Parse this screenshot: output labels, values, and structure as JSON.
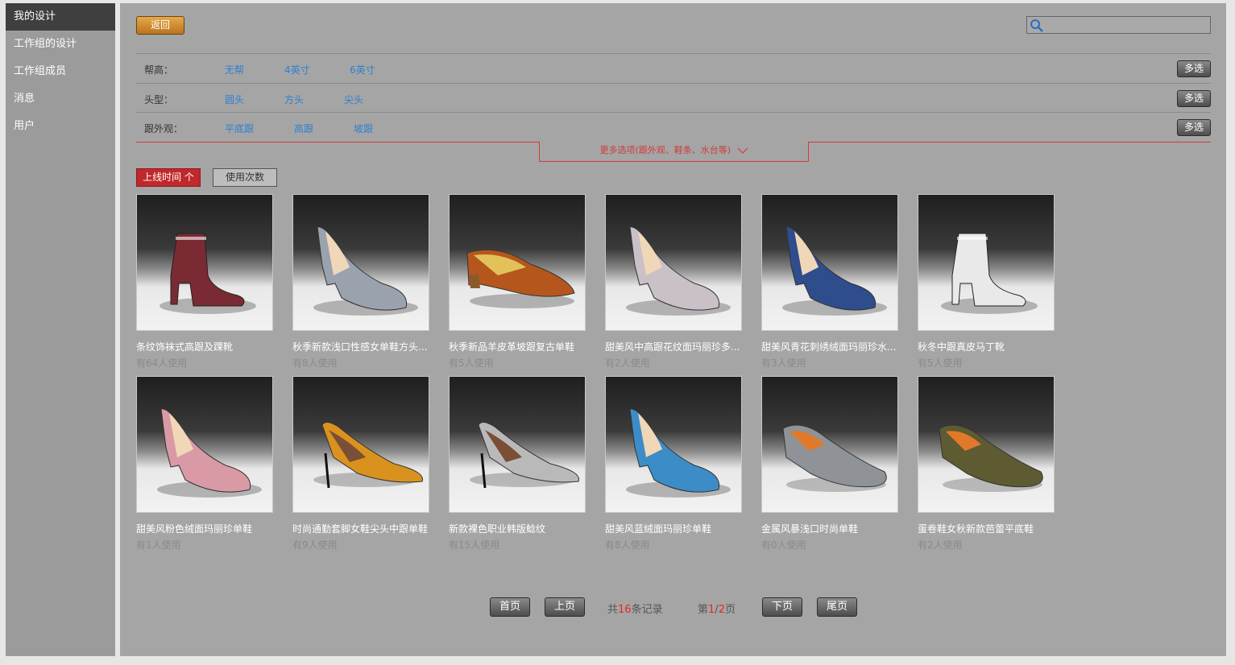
{
  "sidebar": {
    "items": [
      {
        "label": "我的设计",
        "active": true
      },
      {
        "label": "工作组的设计"
      },
      {
        "label": "工作组成员"
      },
      {
        "label": "消息"
      },
      {
        "label": "用户"
      }
    ]
  },
  "toolbar": {
    "back_label": "返回",
    "search_placeholder": ""
  },
  "filters": [
    {
      "label": "帮高：",
      "options": [
        "无帮",
        "4英寸",
        "6英寸"
      ],
      "multi_label": "多选"
    },
    {
      "label": "头型：",
      "options": [
        "圆头",
        "方头",
        "尖头"
      ],
      "multi_label": "多选"
    },
    {
      "label": "跟外观：",
      "options": [
        "平底跟",
        "高跟",
        "坡跟"
      ],
      "multi_label": "多选"
    }
  ],
  "more_options": "更多选项(跟外观、鞋条、水台等)",
  "sort": {
    "active_label": "上线时间",
    "active_arrow": "个",
    "other_label": "使用次数"
  },
  "products": [
    {
      "title": "条纹饰袜式高跟及踝靴",
      "usage": "有64人使用",
      "shoe": "boot",
      "color": "#7a2a32"
    },
    {
      "title": "秋季新款浅口性感女单鞋方头...",
      "usage": "有8人使用",
      "shoe": "pump",
      "color": "#9aa2ad"
    },
    {
      "title": "秋季新品羊皮革坡跟复古单鞋",
      "usage": "有5人使用",
      "shoe": "wedge",
      "color": "#b5561c"
    },
    {
      "title": "甜美风中高跟花纹面玛丽珍多...",
      "usage": "有2人使用",
      "shoe": "pump",
      "color": "#c9c0c8"
    },
    {
      "title": "甜美风青花刺绣绒面玛丽珍水...",
      "usage": "有3人使用",
      "shoe": "pump",
      "color": "#2f4c8c"
    },
    {
      "title": "秋冬中跟真皮马丁靴",
      "usage": "有5人使用",
      "shoe": "boot",
      "color": "#e9e9e9"
    },
    {
      "title": "甜美风粉色绒面玛丽珍单鞋",
      "usage": "有1人使用",
      "shoe": "pump",
      "color": "#d99aa5"
    },
    {
      "title": "时尚通勤套脚女鞋尖头中跟单鞋",
      "usage": "有9人使用",
      "shoe": "stiletto",
      "color": "#d9921e"
    },
    {
      "title": "新款裸色职业韩版鲶纹",
      "usage": "有15人使用",
      "shoe": "stiletto",
      "color": "#b9b9b9"
    },
    {
      "title": "甜美风蓝绒面玛丽珍单鞋",
      "usage": "有8人使用",
      "shoe": "pump",
      "color": "#3c8cc8"
    },
    {
      "title": "金属风暴浅口时尚单鞋",
      "usage": "有0人使用",
      "shoe": "flat",
      "color": "#8f9296"
    },
    {
      "title": "蛋卷鞋女秋新款芭蕾平底鞋",
      "usage": "有2人使用",
      "shoe": "flat",
      "color": "#5e5a32"
    }
  ],
  "pager": {
    "first": "首页",
    "prev": "上页",
    "total_prefix": "共",
    "total": "16",
    "total_suffix": "条记录",
    "page_prefix": "第",
    "page_current": "1",
    "page_sep": "/",
    "page_total": "2",
    "page_suffix": "页",
    "next": "下页",
    "last": "尾页"
  },
  "colors": {
    "accent_red": "#c0282b",
    "link_blue": "#2f7fd0",
    "back_orange": "#d18a30"
  }
}
